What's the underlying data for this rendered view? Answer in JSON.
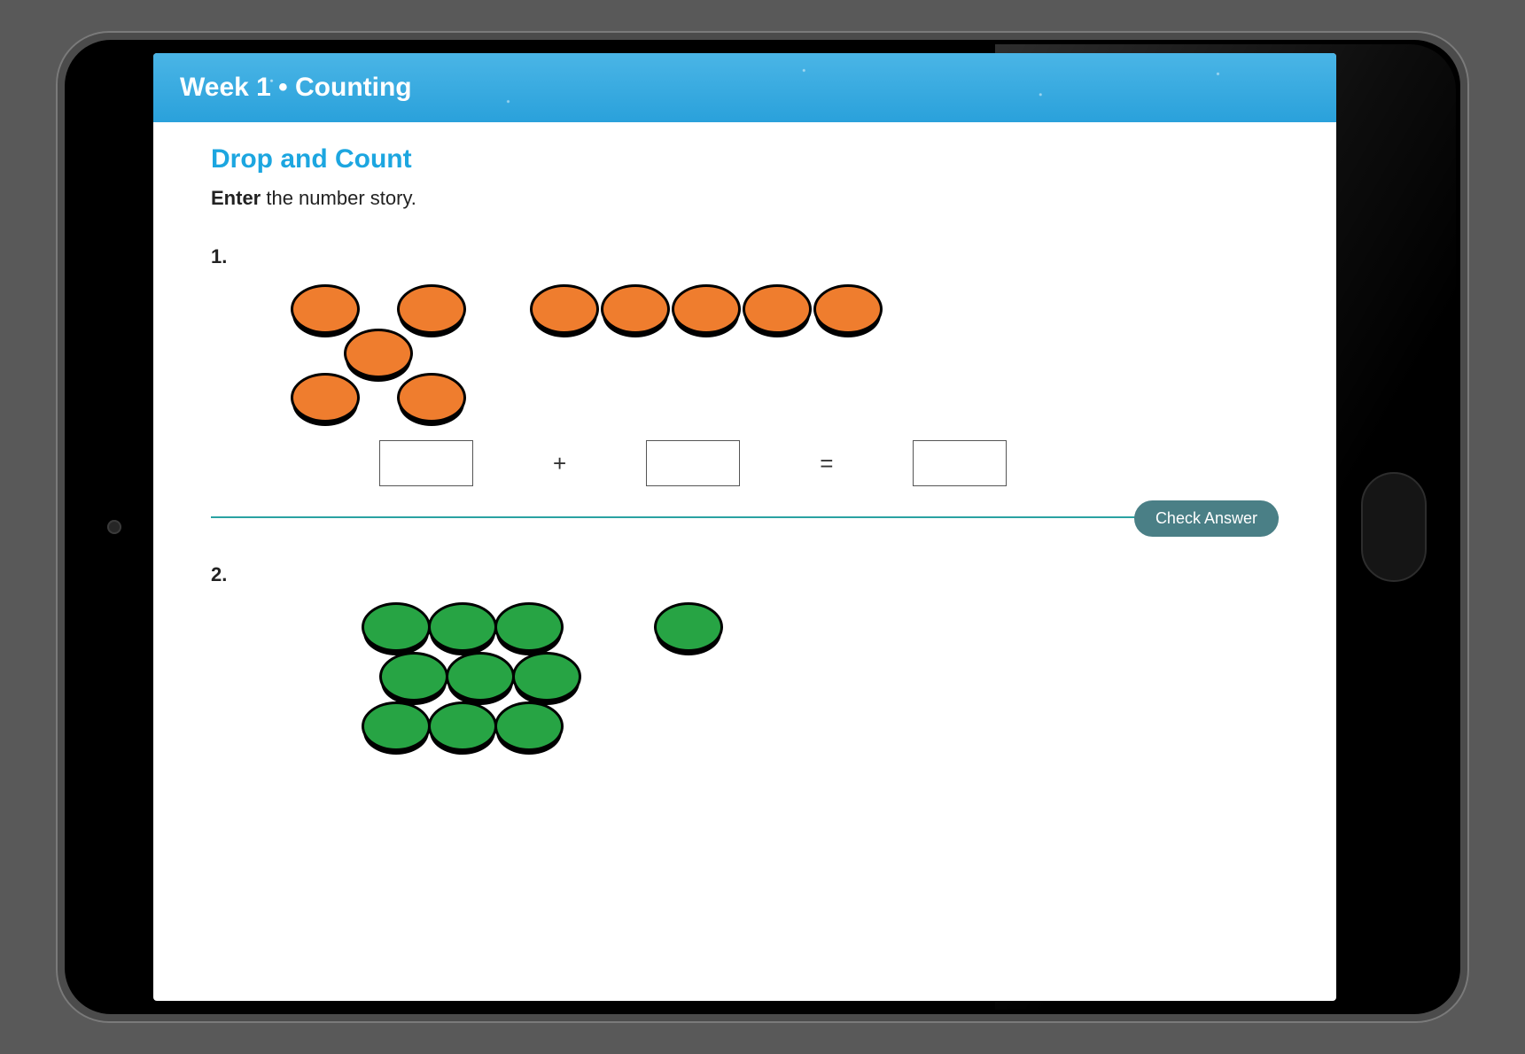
{
  "banner": {
    "title": "Week 1 • Counting"
  },
  "page": {
    "title": "Drop and Count",
    "instr_bold": "Enter",
    "instr_rest": " the number story."
  },
  "q1": {
    "number": "1.",
    "color": "orange",
    "groupA_count": 5,
    "groupB_count": 5,
    "plus": "+",
    "equals": "=",
    "ansA": "",
    "ansB": "",
    "ansC": ""
  },
  "check_label": "Check Answer",
  "q2": {
    "number": "2.",
    "color": "green",
    "groupA_count": 9,
    "groupB_count": 1
  }
}
